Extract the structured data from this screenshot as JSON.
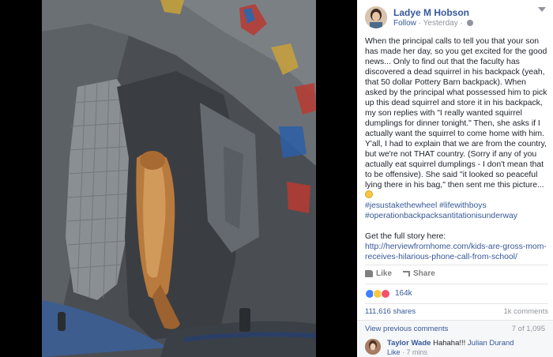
{
  "post": {
    "author": "Ladye M Hobson",
    "follow": "Follow",
    "separator": " · ",
    "time": "Yesterday",
    "dot": " · ",
    "body": {
      "p1": "When the principal calls to tell you that your son has made her day, so you get excited for the good news... Only to find out that the faculty has discovered a dead squirrel in his backpack (yeah, that 50 dollar Pottery Barn backpack). When asked by the principal what possessed him to pick up this dead squirrel and store it in his backpack, my son replies with \"I really wanted squirrel dumplings for dinner tonight.\" Then, she asks if I actually want the squirrel to come home with him. Y'all, I had to explain that we are from the country, but we're not THAT country. (Sorry if any of you actually eat squirrel dumplings - I don't mean that to be offensive). She said \"it looked so peaceful lying there in his bag,\" then sent me this picture...",
      "tag1": "#jesustakethewheel",
      "tag2": "#lifewithboys",
      "tag3": "#operationbackpacksantitationisunderway",
      "story_label": "Get the full story here:",
      "link": "http://herviewfromhome.com/kids-are-gross-mom-receives-hilarious-phone-call-from-school/"
    }
  },
  "actions": {
    "like": "Like",
    "share": "Share"
  },
  "reactions": {
    "count": "164k"
  },
  "stats": {
    "shares": "111,616 shares",
    "comments": "1k comments"
  },
  "comments_section": {
    "view_more": "View previous comments",
    "position": "7 of 1,095"
  },
  "comment": {
    "author": "Taylor Wade",
    "text": "Hahaha!!!",
    "tagged": "Julian Durand",
    "like": "Like",
    "separator": " · ",
    "time": "7 mins"
  },
  "icons": {
    "globe": "globe-icon",
    "options": "chevron-down-icon",
    "like": "thumbs-up-icon",
    "share": "share-arrow-icon",
    "emoji": "smile-emoji-icon"
  },
  "colors": {
    "link": "#365899",
    "like_reaction": "#4080ff",
    "haha_reaction": "#f7c841",
    "love_reaction": "#f25268"
  }
}
